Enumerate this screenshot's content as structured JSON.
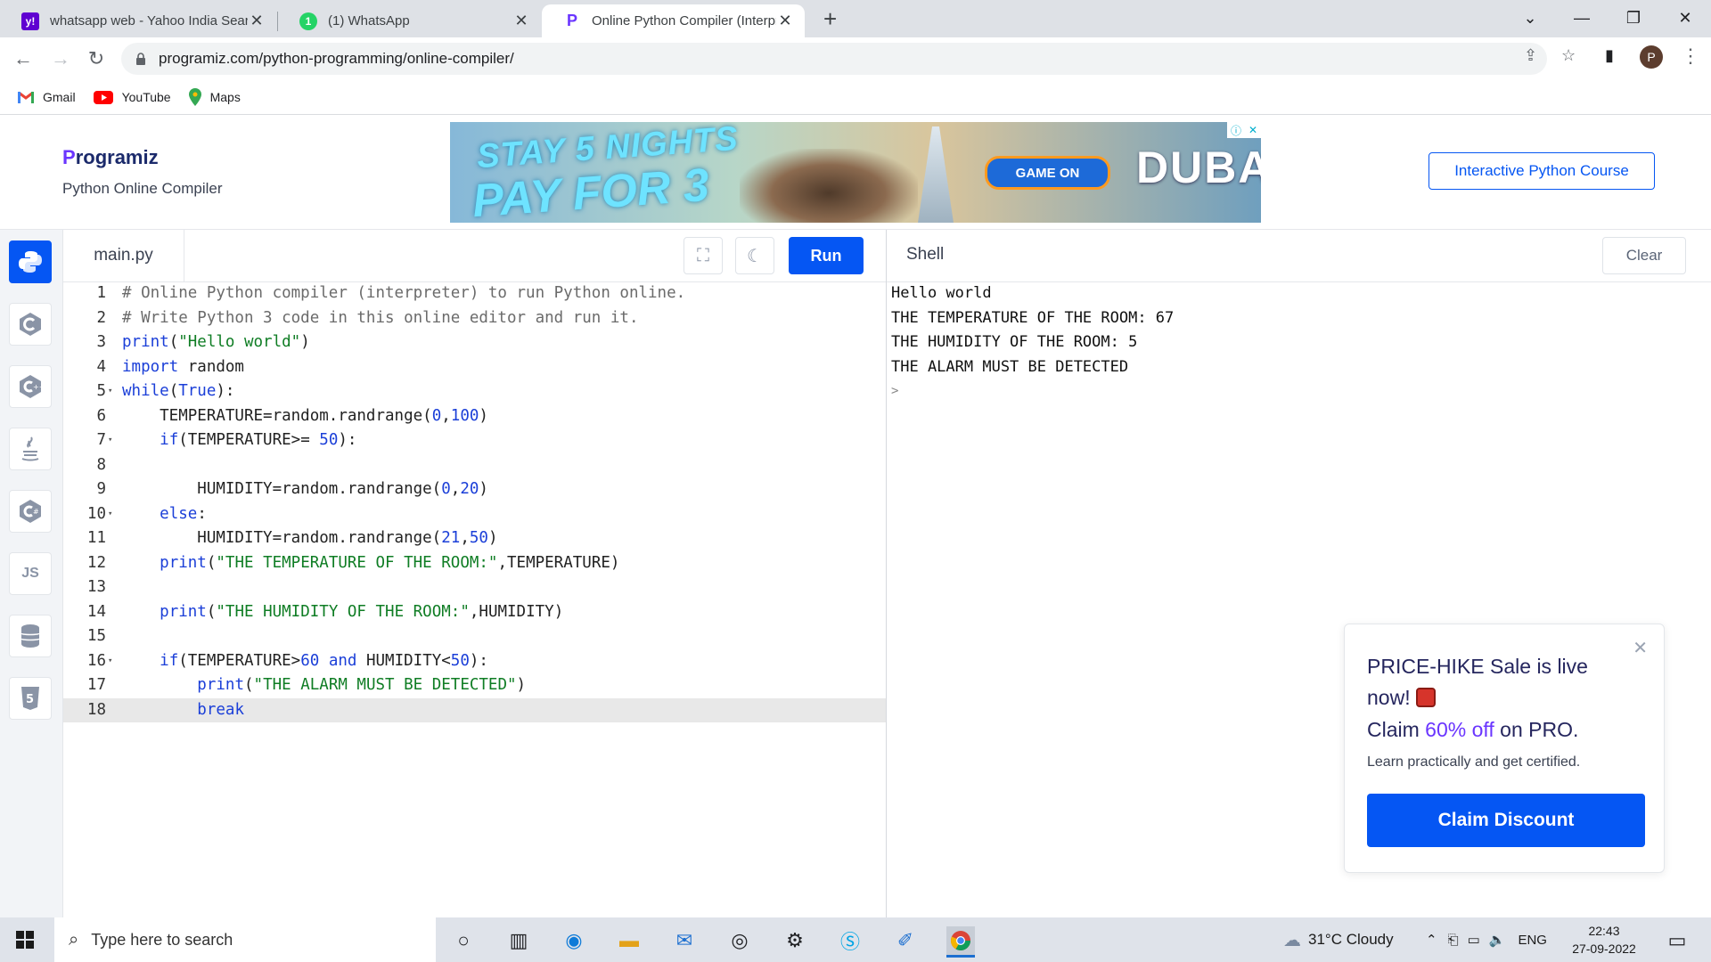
{
  "browser": {
    "tabs": [
      {
        "title": "whatsapp web - Yahoo India Sear",
        "favicon": "yahoo-icon",
        "active": false
      },
      {
        "title": "(1) WhatsApp",
        "favicon": "whatsapp-icon",
        "badge": "1",
        "active": false
      },
      {
        "title": "Online Python Compiler (Interpre",
        "favicon": "programiz-icon",
        "active": true
      }
    ],
    "url": "programiz.com/python-programming/online-compiler/",
    "profile_initial": "P",
    "bookmarks": [
      {
        "label": "Gmail",
        "icon": "gmail-icon"
      },
      {
        "label": "YouTube",
        "icon": "youtube-icon"
      },
      {
        "label": "Maps",
        "icon": "maps-icon"
      }
    ]
  },
  "site": {
    "logo": "Programiz",
    "logo_first": "P",
    "logo_rest": "rogramiz",
    "subtitle": "Python Online Compiler",
    "course_button": "Interactive Python Course",
    "ad": {
      "line1": "STAY 5 NIGHTS",
      "line2": "PAY FOR 3",
      "cta": "GAME ON",
      "brand": "DUBAI"
    }
  },
  "rail": {
    "items": [
      "python-icon",
      "c-icon",
      "cpp-icon",
      "java-icon",
      "csharp-icon",
      "js-icon",
      "database-icon",
      "html5-icon"
    ],
    "js_label": "JS"
  },
  "editor": {
    "filename": "main.py",
    "run_label": "Run",
    "lines": [
      "# Online Python compiler (interpreter) to run Python online.",
      "# Write Python 3 code in this online editor and run it.",
      "print(\"Hello world\")",
      "import random",
      "while(True):",
      "    TEMPERATURE=random.randrange(0,100)",
      "    if(TEMPERATURE>= 50):",
      "",
      "        HUMIDITY=random.randrange(0,20)",
      "    else:",
      "        HUMIDITY=random.randrange(21,50)",
      "    print(\"THE TEMPERATURE OF THE ROOM:\",TEMPERATURE)",
      "",
      "    print(\"THE HUMIDITY OF THE ROOM:\",HUMIDITY)",
      "",
      "    if(TEMPERATURE>60 and HUMIDITY<50):",
      "        print(\"THE ALARM MUST BE DETECTED\")",
      "        break"
    ],
    "fold_lines": [
      5,
      7,
      10,
      16
    ],
    "current_line": 18
  },
  "shell": {
    "title": "Shell",
    "clear_label": "Clear",
    "output": [
      "Hello world",
      "THE TEMPERATURE OF THE ROOM: 67",
      "THE HUMIDITY OF THE ROOM: 5",
      "THE ALARM MUST BE DETECTED"
    ],
    "prompt": ">"
  },
  "promo": {
    "headline": "PRICE-HIKE Sale is live now!",
    "claim_prefix": "Claim ",
    "claim_highlight": "60% off",
    "claim_suffix": " on PRO.",
    "sub": "Learn practically and get certified.",
    "button": "Claim Discount",
    "accent": "#6a35ff"
  },
  "taskbar": {
    "search_placeholder": "Type here to search",
    "weather": "31°C  Cloudy",
    "language": "ENG",
    "time": "22:43",
    "date": "27-09-2022"
  },
  "colors": {
    "primary": "#0556f3",
    "keyword": "#1b3fd8",
    "string": "#0f7d24",
    "comment": "#6b6b6b",
    "number": "#1b3fd8"
  }
}
